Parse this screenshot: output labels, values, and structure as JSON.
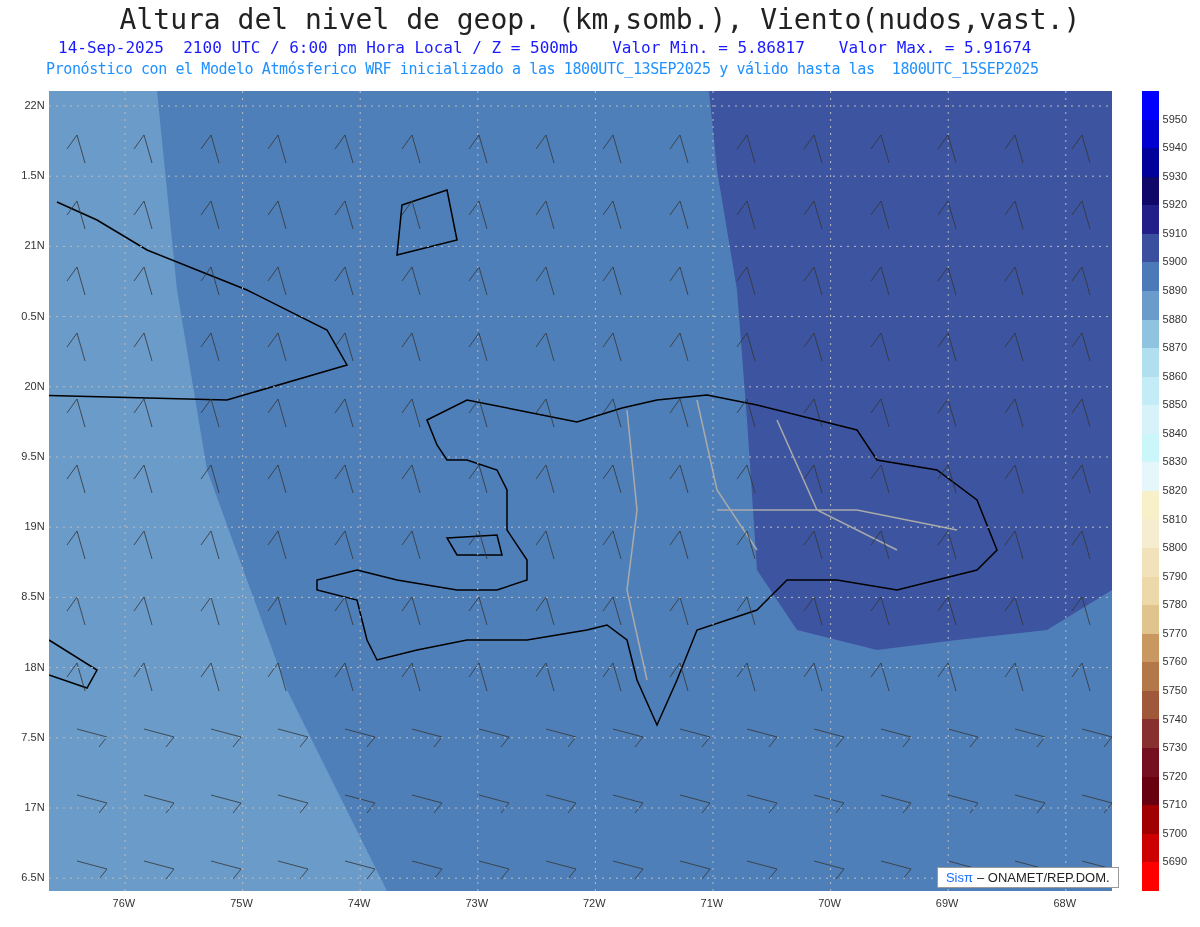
{
  "title": "Altura del nivel de geop. (km,somb.), Viento(nudos,vast.)",
  "subtitle": [
    "14-Sep-2025  2100 UTC / 6:00 pm Hora Local / Z = 500mb",
    "Valor Min. = 5.86817",
    "Valor Max. = 5.91674"
  ],
  "note": "Pronóstico con el Modelo Atmósferico WRF inicializado a las 1800UTC_13SEP2025 y válido hasta las  1800UTC_15SEP2025",
  "map": {
    "lat_labels": [
      "22N",
      "1.5N",
      "21N",
      "0.5N",
      "20N",
      "9.5N",
      "19N",
      "8.5N",
      "18N",
      "7.5N",
      "17N",
      "6.5N"
    ],
    "lon_labels": [
      "76W",
      "75W",
      "74W",
      "73W",
      "72W",
      "71W",
      "70W",
      "69W",
      "68W"
    ],
    "credit": {
      "brand": "Sisπ",
      "text": "– ONAMET/REP.DOM."
    }
  },
  "legend": {
    "labels": [
      "5950",
      "5940",
      "5930",
      "5920",
      "5910",
      "5900",
      "5890",
      "5880",
      "5870",
      "5860",
      "5850",
      "5840",
      "5830",
      "5820",
      "5810",
      "5800",
      "5790",
      "5780",
      "5770",
      "5760",
      "5750",
      "5740",
      "5730",
      "5720",
      "5710",
      "5700",
      "5690"
    ],
    "cells": [
      {
        "color": "#0000ff"
      },
      {
        "color": "#0000d0"
      },
      {
        "color": "#00009a"
      },
      {
        "color": "#100868"
      },
      {
        "color": "#221f88"
      },
      {
        "color": "#3a4f9e"
      },
      {
        "color": "#4c7ab8"
      },
      {
        "color": "#6a9bcb"
      },
      {
        "color": "#8fc3df"
      },
      {
        "color": "#b0dff0"
      },
      {
        "color": "#c4ecf6"
      },
      {
        "color": "#d8f2fa"
      },
      {
        "color": "#cbf7fb"
      },
      {
        "color": "#e6f7fb"
      },
      {
        "color": "#f8f0c8"
      },
      {
        "color": "#f6ecd0"
      },
      {
        "color": "#f2e2bc"
      },
      {
        "color": "#ecd8a8"
      },
      {
        "color": "#e0c48e"
      },
      {
        "color": "#c89860"
      },
      {
        "color": "#b47848"
      },
      {
        "color": "#a0583a"
      },
      {
        "color": "#883030"
      },
      {
        "color": "#741020"
      },
      {
        "color": "#680010"
      },
      {
        "color": "#a00000"
      },
      {
        "color": "#cc0000"
      },
      {
        "color": "#ff0000"
      }
    ]
  }
}
